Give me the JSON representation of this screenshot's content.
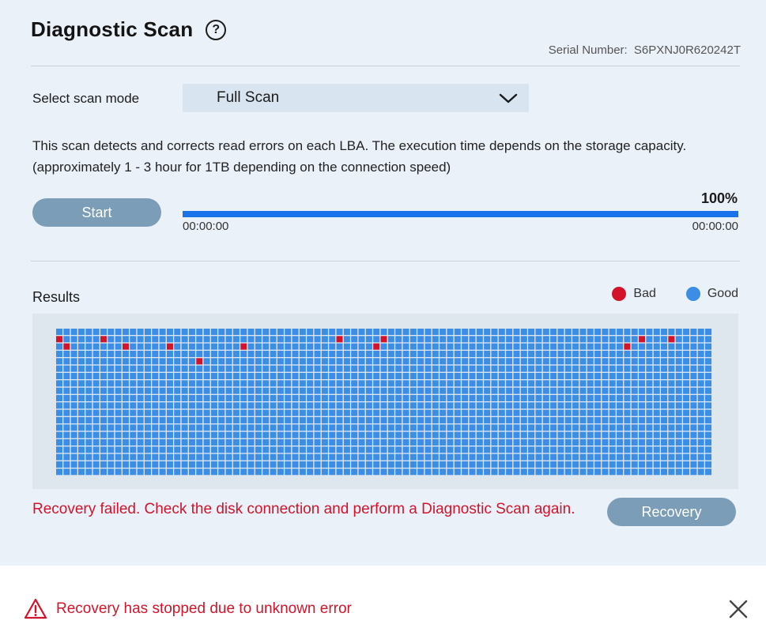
{
  "header": {
    "title": "Diagnostic Scan",
    "help_icon": "question-circle-icon",
    "serial_label": "Serial Number:",
    "serial_value": "S6PXNJ0R620242T"
  },
  "scan_mode": {
    "label": "Select scan mode",
    "selected": "Full Scan",
    "icon": "chevron-down-icon"
  },
  "description": "This scan detects and corrects read errors on each LBA. The execution time depends on the storage capacity. (approximately 1 - 3 hour for 1TB depending on the connection speed)",
  "controls": {
    "start_label": "Start",
    "progress_text": "100%",
    "progress_value": 1.0,
    "elapsed": "00:00:00",
    "remaining": "00:00:00"
  },
  "results": {
    "label": "Results",
    "legend": [
      {
        "label": "Bad",
        "color": "#d3132a"
      },
      {
        "label": "Good",
        "color": "#3b8de6"
      }
    ],
    "grid": {
      "columns": 89,
      "rows": 20,
      "good_color": "#3b8de6",
      "bad_color": "#d3132a",
      "bad_cells": [
        [
          1,
          0
        ],
        [
          1,
          6
        ],
        [
          1,
          38
        ],
        [
          1,
          44
        ],
        [
          1,
          79
        ],
        [
          1,
          83
        ],
        [
          2,
          1
        ],
        [
          2,
          9
        ],
        [
          2,
          15
        ],
        [
          2,
          25
        ],
        [
          2,
          43
        ],
        [
          2,
          77
        ],
        [
          4,
          19
        ]
      ]
    }
  },
  "error_message": "Recovery failed. Check the disk connection and perform a Diagnostic Scan again.",
  "recovery_label": "Recovery",
  "notification": {
    "icon": "warning-triangle-icon",
    "text": "Recovery has stopped due to unknown error",
    "close_icon": "close-icon"
  }
}
